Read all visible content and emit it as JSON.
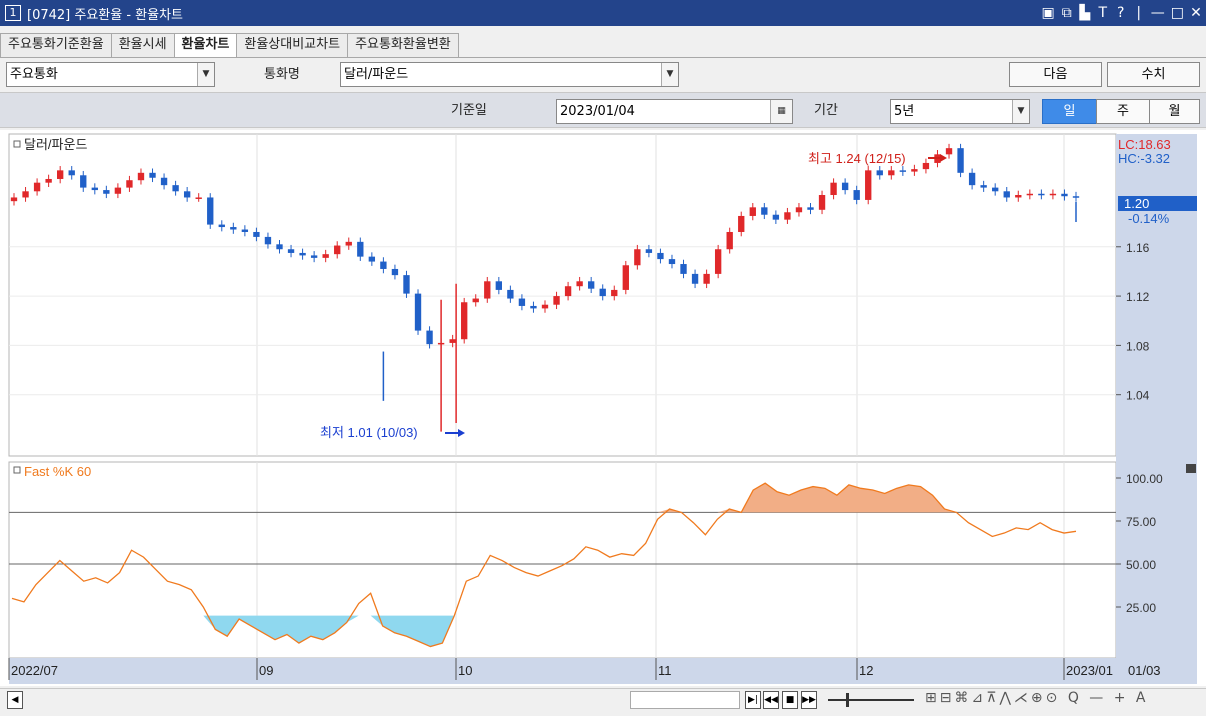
{
  "window": {
    "num": "1",
    "title": "[0742] 주요환율 - 환율차트",
    "buttons": [
      "▣",
      "⧉",
      "▙",
      "T",
      "?",
      "|",
      "—",
      "□",
      "✕"
    ]
  },
  "tabs": [
    "주요통화기준환율",
    "환율시세",
    "환율차트",
    "환율상대비교차트",
    "주요통화환율변환"
  ],
  "active_tab": 2,
  "toolbar": {
    "currency_group": "주요통화",
    "currency_label": "통화명",
    "currency_value": "달러/파운드",
    "next_label": "다음",
    "numeric_label": "수치",
    "base_date_label": "기준일",
    "base_date": "2023/01/04",
    "period_label": "기간",
    "period_value": "5년",
    "unit_day": "일",
    "unit_week": "주",
    "unit_month": "월"
  },
  "colors": {
    "up": "#e0282a",
    "down": "#2060c8",
    "titlebar": "#23448b",
    "axis_bg": "#cdd7ea",
    "stoch_line": "#f07a1e",
    "stoch_over": "#f2ae86",
    "stoch_under": "#8fd8ef"
  },
  "chart_data": [
    {
      "type": "candlestick",
      "series_label": "달러/파운드",
      "lc": "LC:18.63",
      "hc": "HC:-3.32",
      "last_value": "1.20",
      "last_change": "-0.14%",
      "max_annotation": "최고 1.24 (12/15)",
      "min_annotation": "최저 1.01 (10/03)",
      "yticks": [
        "1.16",
        "1.12",
        "1.08",
        "1.04"
      ],
      "ylim": [
        1.0,
        1.245
      ],
      "xlabels": [
        "2022/07",
        "09",
        "10",
        "11",
        "12",
        "2023/01"
      ],
      "current_label": "01/03",
      "high": 1.24,
      "low": 1.01,
      "close_series": [
        1.2,
        1.205,
        1.212,
        1.215,
        1.222,
        1.218,
        1.208,
        1.206,
        1.203,
        1.208,
        1.214,
        1.22,
        1.216,
        1.21,
        1.205,
        1.2,
        1.2,
        1.178,
        1.176,
        1.174,
        1.172,
        1.168,
        1.162,
        1.158,
        1.155,
        1.153,
        1.151,
        1.154,
        1.161,
        1.164,
        1.152,
        1.148,
        1.142,
        1.137,
        1.122,
        1.092,
        1.081,
        1.082,
        1.085,
        1.115,
        1.118,
        1.132,
        1.125,
        1.118,
        1.112,
        1.11,
        1.113,
        1.12,
        1.128,
        1.132,
        1.126,
        1.12,
        1.125,
        1.145,
        1.158,
        1.155,
        1.15,
        1.146,
        1.138,
        1.13,
        1.138,
        1.158,
        1.172,
        1.185,
        1.192,
        1.186,
        1.182,
        1.188,
        1.192,
        1.19,
        1.202,
        1.212,
        1.206,
        1.198,
        1.222,
        1.218,
        1.222,
        1.221,
        1.223,
        1.228,
        1.235,
        1.24,
        1.22,
        1.21,
        1.208,
        1.205,
        1.2,
        1.202,
        1.203,
        1.202,
        1.203,
        1.201,
        1.2
      ]
    },
    {
      "type": "line",
      "series_label": "Fast %K 60",
      "yticks": [
        "100.00",
        "75.00",
        "50.00",
        "25.00"
      ],
      "ylim": [
        0,
        100
      ],
      "reference_lines": [
        80,
        50
      ],
      "shade_below": 20,
      "values": [
        30,
        28,
        38,
        45,
        52,
        46,
        40,
        42,
        39,
        45,
        58,
        54,
        47,
        40,
        38,
        35,
        25,
        12,
        8,
        18,
        14,
        10,
        6,
        9,
        4,
        8,
        6,
        10,
        16,
        27,
        33,
        14,
        10,
        8,
        5,
        2,
        4,
        20,
        40,
        43,
        55,
        52,
        48,
        45,
        43,
        46,
        49,
        53,
        60,
        58,
        54,
        56,
        55,
        62,
        76,
        82,
        80,
        74,
        67,
        76,
        82,
        80,
        93,
        97,
        92,
        90,
        93,
        95,
        94,
        90,
        96,
        94,
        93,
        91,
        94,
        96,
        95,
        90,
        82,
        80,
        74,
        70,
        66,
        68,
        71,
        70,
        74,
        70,
        68,
        69
      ]
    }
  ],
  "bottom": {
    "scroll_left": "◀",
    "nav_buttons": [
      "▶|",
      "◀◀",
      "■",
      "▶▶"
    ],
    "tool_icons": "⊞⊟⌘⊿⊼⋀⋌⊕⊙ Q — + A"
  }
}
